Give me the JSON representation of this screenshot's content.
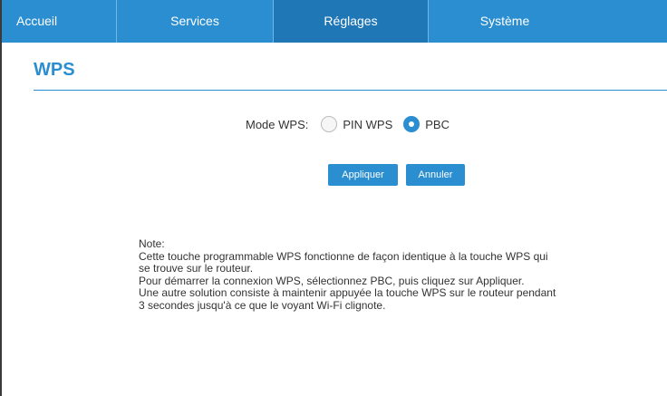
{
  "nav": {
    "items": [
      {
        "label": "Accueil",
        "active": false
      },
      {
        "label": "Services",
        "active": false
      },
      {
        "label": "Réglages",
        "active": true
      },
      {
        "label": "Système",
        "active": false
      }
    ]
  },
  "page": {
    "title": "WPS"
  },
  "wps": {
    "mode_label": "Mode WPS:",
    "options": [
      {
        "label": "PIN WPS",
        "checked": false
      },
      {
        "label": "PBC",
        "checked": true
      }
    ]
  },
  "actions": {
    "apply_label": "Appliquer",
    "cancel_label": "Annuler"
  },
  "note": {
    "lines": [
      "Note:",
      "Cette touche programmable WPS fonctionne de façon identique à la touche WPS qui",
      "se trouve sur le routeur.",
      "Pour démarrer la connexion WPS, sélectionnez PBC, puis cliquez sur Appliquer.",
      "Une autre solution consiste à maintenir appuyée la touche WPS sur le routeur pendant",
      "3 secondes jusqu'à ce que le voyant Wi-Fi clignote."
    ]
  },
  "colors": {
    "accent": "#2a8ed0",
    "nav_active": "#1f77b6"
  }
}
